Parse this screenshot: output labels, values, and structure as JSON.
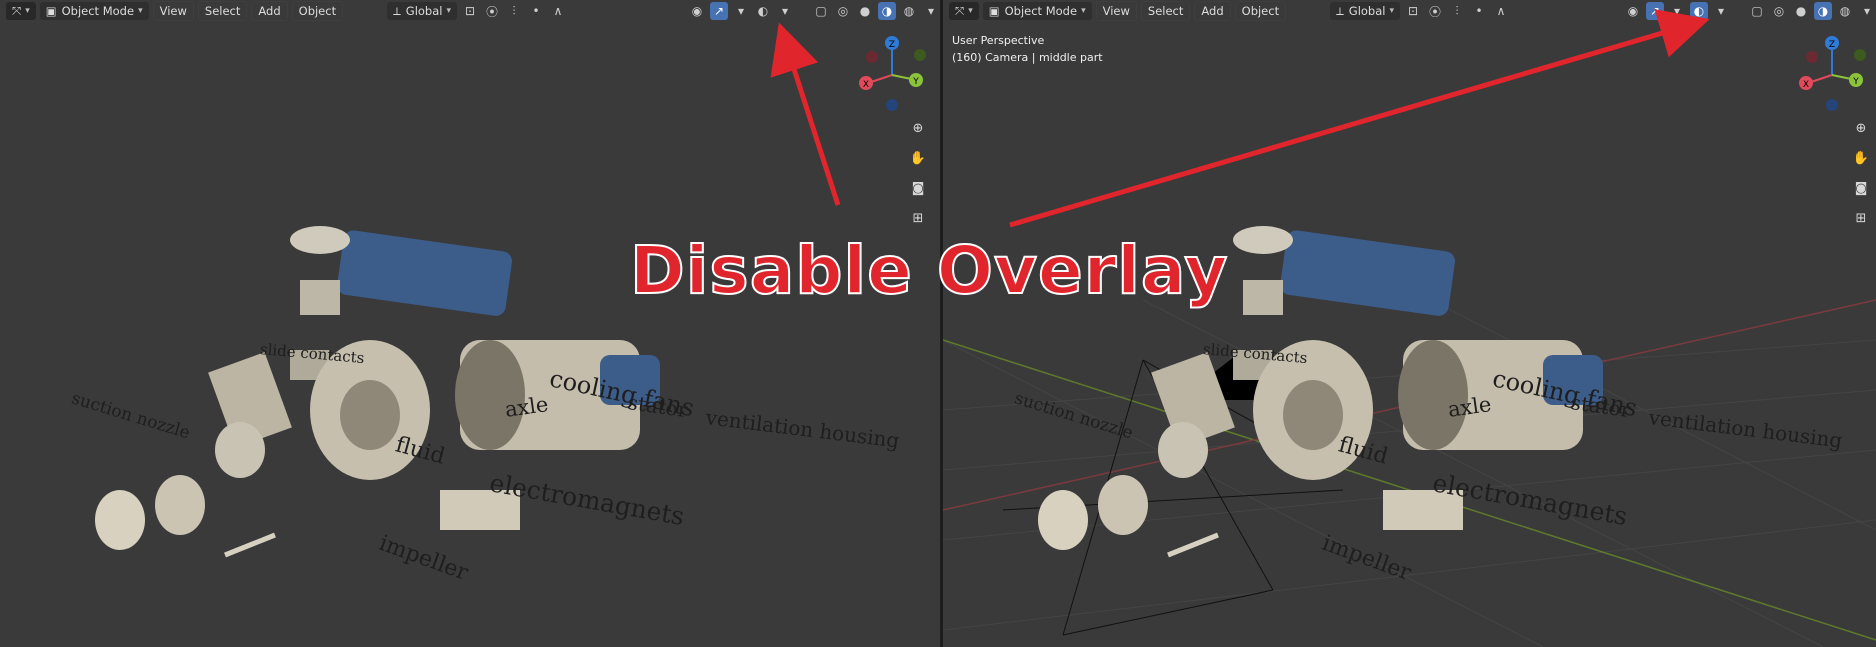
{
  "left_viewport": {
    "header": {
      "mode": "Object Mode",
      "menus": [
        "View",
        "Select",
        "Add",
        "Object"
      ],
      "orientation": "Global"
    },
    "labels": [
      "suction nozzle",
      "slide contacts",
      "cooling fans",
      "stator",
      "axle",
      "ventilation housing",
      "fluid",
      "electromagnets",
      "impeller"
    ]
  },
  "right_viewport": {
    "header": {
      "mode": "Object Mode",
      "menus": [
        "View",
        "Select",
        "Add",
        "Object"
      ],
      "orientation": "Global"
    },
    "info": {
      "perspective": "User Perspective",
      "camera": "(160) Camera | middle part"
    },
    "labels": [
      "suction nozzle",
      "slide contacts",
      "cooling fans",
      "stator",
      "axle",
      "ventilation housing",
      "fluid",
      "electromagnets",
      "impeller"
    ]
  },
  "gizmo": {
    "z": "Z",
    "x": "X",
    "y": "Y"
  },
  "annotation": {
    "caption": "Disable Overlay",
    "arrow_color": "#e1252c"
  },
  "colors": {
    "viewport_bg": "#3a3a3a",
    "header_bg": "#303030",
    "accent": "#4772b3",
    "caption": "#e1252c"
  }
}
